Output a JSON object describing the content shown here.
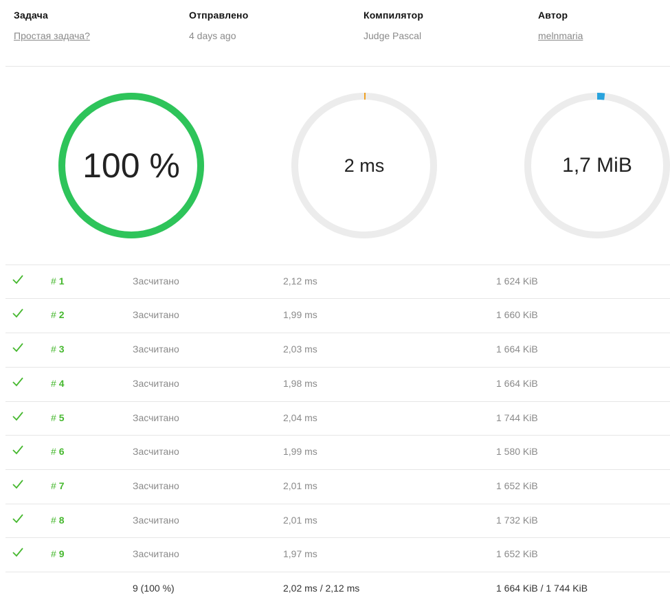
{
  "header": {
    "task_label": "Задача",
    "task_value": "Простая задача?",
    "sent_label": "Отправлено",
    "sent_value": "4 days ago",
    "compiler_label": "Компилятор",
    "compiler_value": "Judge Pascal",
    "author_label": "Автор",
    "author_value": "melnmaria"
  },
  "rings": {
    "score": {
      "text": "100 %",
      "fraction": 1.0,
      "color": "#2ec45a"
    },
    "time": {
      "text": "2 ms",
      "fraction": 0.003,
      "color": "#f0a020"
    },
    "memory": {
      "text": "1,7 MiB",
      "fraction": 0.017,
      "color": "#29a3dd"
    }
  },
  "tests": [
    {
      "hash": "#",
      "num": "1",
      "status": "Засчитано",
      "time": "2,12 ms",
      "memory": "1 624 KiB"
    },
    {
      "hash": "#",
      "num": "2",
      "status": "Засчитано",
      "time": "1,99 ms",
      "memory": "1 660 KiB"
    },
    {
      "hash": "#",
      "num": "3",
      "status": "Засчитано",
      "time": "2,03 ms",
      "memory": "1 664 KiB"
    },
    {
      "hash": "#",
      "num": "4",
      "status": "Засчитано",
      "time": "1,98 ms",
      "memory": "1 664 KiB"
    },
    {
      "hash": "#",
      "num": "5",
      "status": "Засчитано",
      "time": "2,04 ms",
      "memory": "1 744 KiB"
    },
    {
      "hash": "#",
      "num": "6",
      "status": "Засчитано",
      "time": "1,99 ms",
      "memory": "1 580 KiB"
    },
    {
      "hash": "#",
      "num": "7",
      "status": "Засчитано",
      "time": "2,01 ms",
      "memory": "1 652 KiB"
    },
    {
      "hash": "#",
      "num": "8",
      "status": "Засчитано",
      "time": "2,01 ms",
      "memory": "1 732 KiB"
    },
    {
      "hash": "#",
      "num": "9",
      "status": "Засчитано",
      "time": "1,97 ms",
      "memory": "1 652 KiB"
    }
  ],
  "summary": {
    "passed": "9 (100 %)",
    "time": "2,02 ms / 2,12 ms",
    "memory": "1 664 KiB / 1 744 KiB"
  },
  "icons": {
    "test_passed": "check-icon"
  },
  "colors": {
    "pass_green": "#46b82f",
    "ring_track": "#ececec"
  }
}
